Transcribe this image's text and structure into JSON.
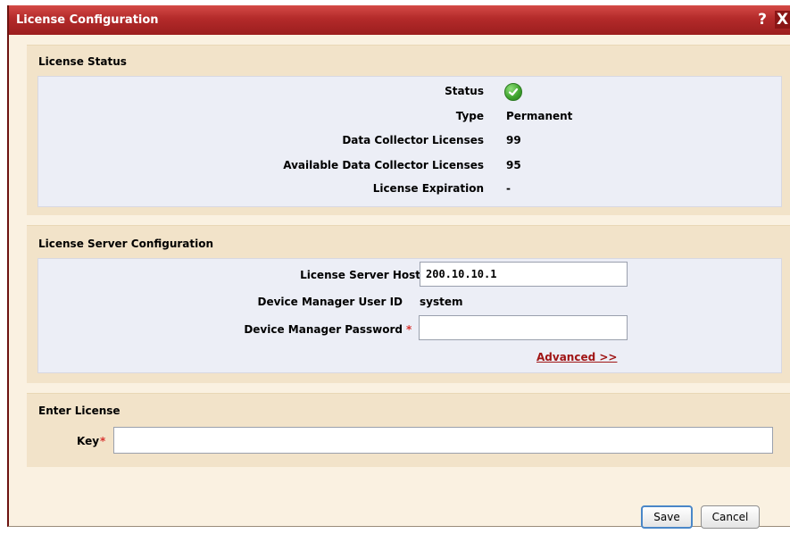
{
  "window": {
    "title": "License Configuration",
    "help_label": "?",
    "close_label": "X"
  },
  "license_status": {
    "section_title": "License Status",
    "rows": [
      {
        "label": "Status",
        "value": "",
        "icon": "check-circle-icon"
      },
      {
        "label": "Type",
        "value": "Permanent"
      },
      {
        "label": "Data Collector Licenses",
        "value": "99"
      },
      {
        "label": "Available Data Collector Licenses",
        "value": "95"
      },
      {
        "label": "License Expiration",
        "value": "-"
      }
    ]
  },
  "server_config": {
    "section_title": "License Server Configuration",
    "host_label": "License Server Host",
    "host_value": "200.10.10.1",
    "user_label": "Device Manager User ID",
    "user_value": "system",
    "password_label": "Device Manager Password",
    "password_value": "",
    "advanced_label": "Advanced >>",
    "required_marker": "*"
  },
  "enter_license": {
    "section_title": "Enter License",
    "key_label": "Key",
    "key_value": "",
    "required_marker": "*"
  },
  "buttons": {
    "save_label": "Save",
    "cancel_label": "Cancel"
  },
  "colors": {
    "title_bar": "#b32a2a",
    "required": "#d8332f",
    "link": "#a01515"
  }
}
